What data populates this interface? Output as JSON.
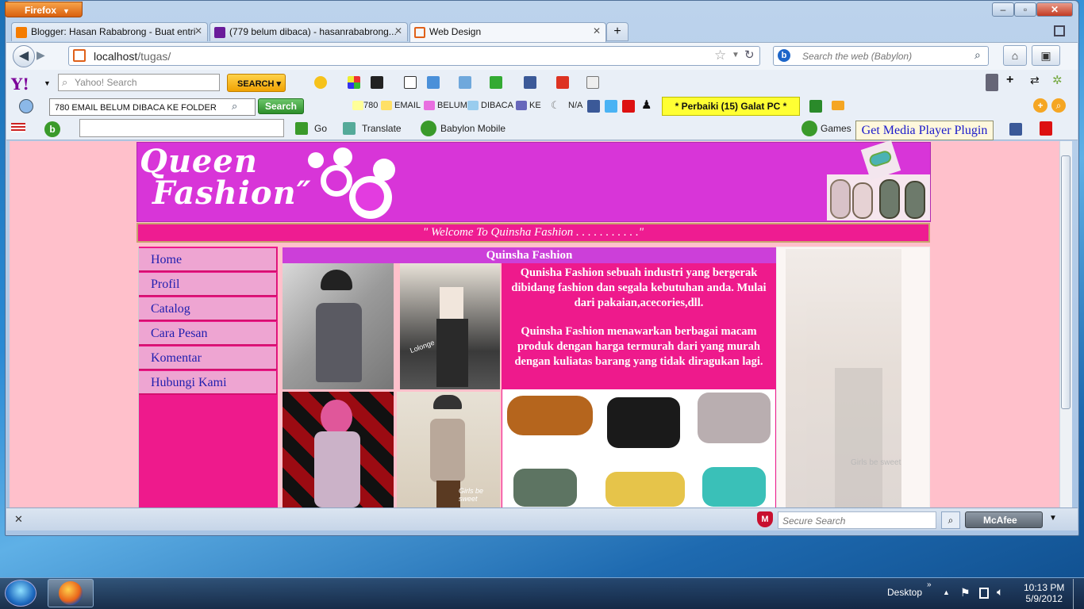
{
  "browser": {
    "menu_button": "Firefox",
    "window_controls": [
      "–",
      "▫",
      "✕"
    ],
    "tabs": [
      {
        "title": "Blogger: Hasan Rababrong - Buat entri",
        "icon_color": "#f57c00"
      },
      {
        "title": "(779 belum dibaca) - hasanrababrong...",
        "icon_color": "#6a1b9a"
      },
      {
        "title": "Web Design",
        "icon_color": "#e0611a"
      }
    ],
    "address_host": "localhost",
    "address_path": "/tugas/",
    "search_placeholder": "Search the web (Babylon)"
  },
  "yahoo_toolbar": {
    "logo": "Y!",
    "search_placeholder": "Yahoo! Search",
    "search_button": "SEARCH"
  },
  "mail_toolbar": {
    "input_value": "780 EMAIL BELUM DIBACA KE FOLDER",
    "search_button": "Search",
    "labels": [
      "780",
      "EMAIL",
      "BELUM",
      "DIBACA",
      "KE"
    ],
    "na_label": "N/A",
    "galat_button": "* Perbaiki (15) Galat PC *"
  },
  "babylon_toolbar": {
    "go_label": "Go",
    "translate_label": "Translate",
    "mobile_label": "Babylon Mobile",
    "games_label": "Games",
    "plugin_notice": "Get Media Player Plugin"
  },
  "page": {
    "logo_line1": "Queen",
    "logo_line2": "Fashion",
    "welcome": "\" Welcome To Quinsha Fashion . . . . . . . . . . .\"",
    "nav_items": [
      "Home",
      "Profil",
      "Catalog",
      "Cara Pesan",
      "Komentar",
      "Hubungi Kami"
    ],
    "section_title": "Quinsha Fashion",
    "desc_p1": "Qunisha Fashion sebuah industri yang bergerak dibidang fashion dan segala kebutuhan anda. Mulai dari pakaian,acecories,dll.",
    "desc_p2": "Quinsha Fashion menawarkan berbagai macam produk dengan harga termurah dari yang murah dengan kuliatas barang yang tidak diragukan lagi.",
    "photo_caption_1": "Girls be sweet",
    "photo_caption_2": "Lolonge"
  },
  "addon_bar": {
    "secure_search_placeholder": "Secure Search",
    "mcafee_label": "McAfee"
  },
  "taskbar": {
    "desktop_label": "Desktop",
    "time": "10:13 PM",
    "date": "5/9/2012"
  }
}
